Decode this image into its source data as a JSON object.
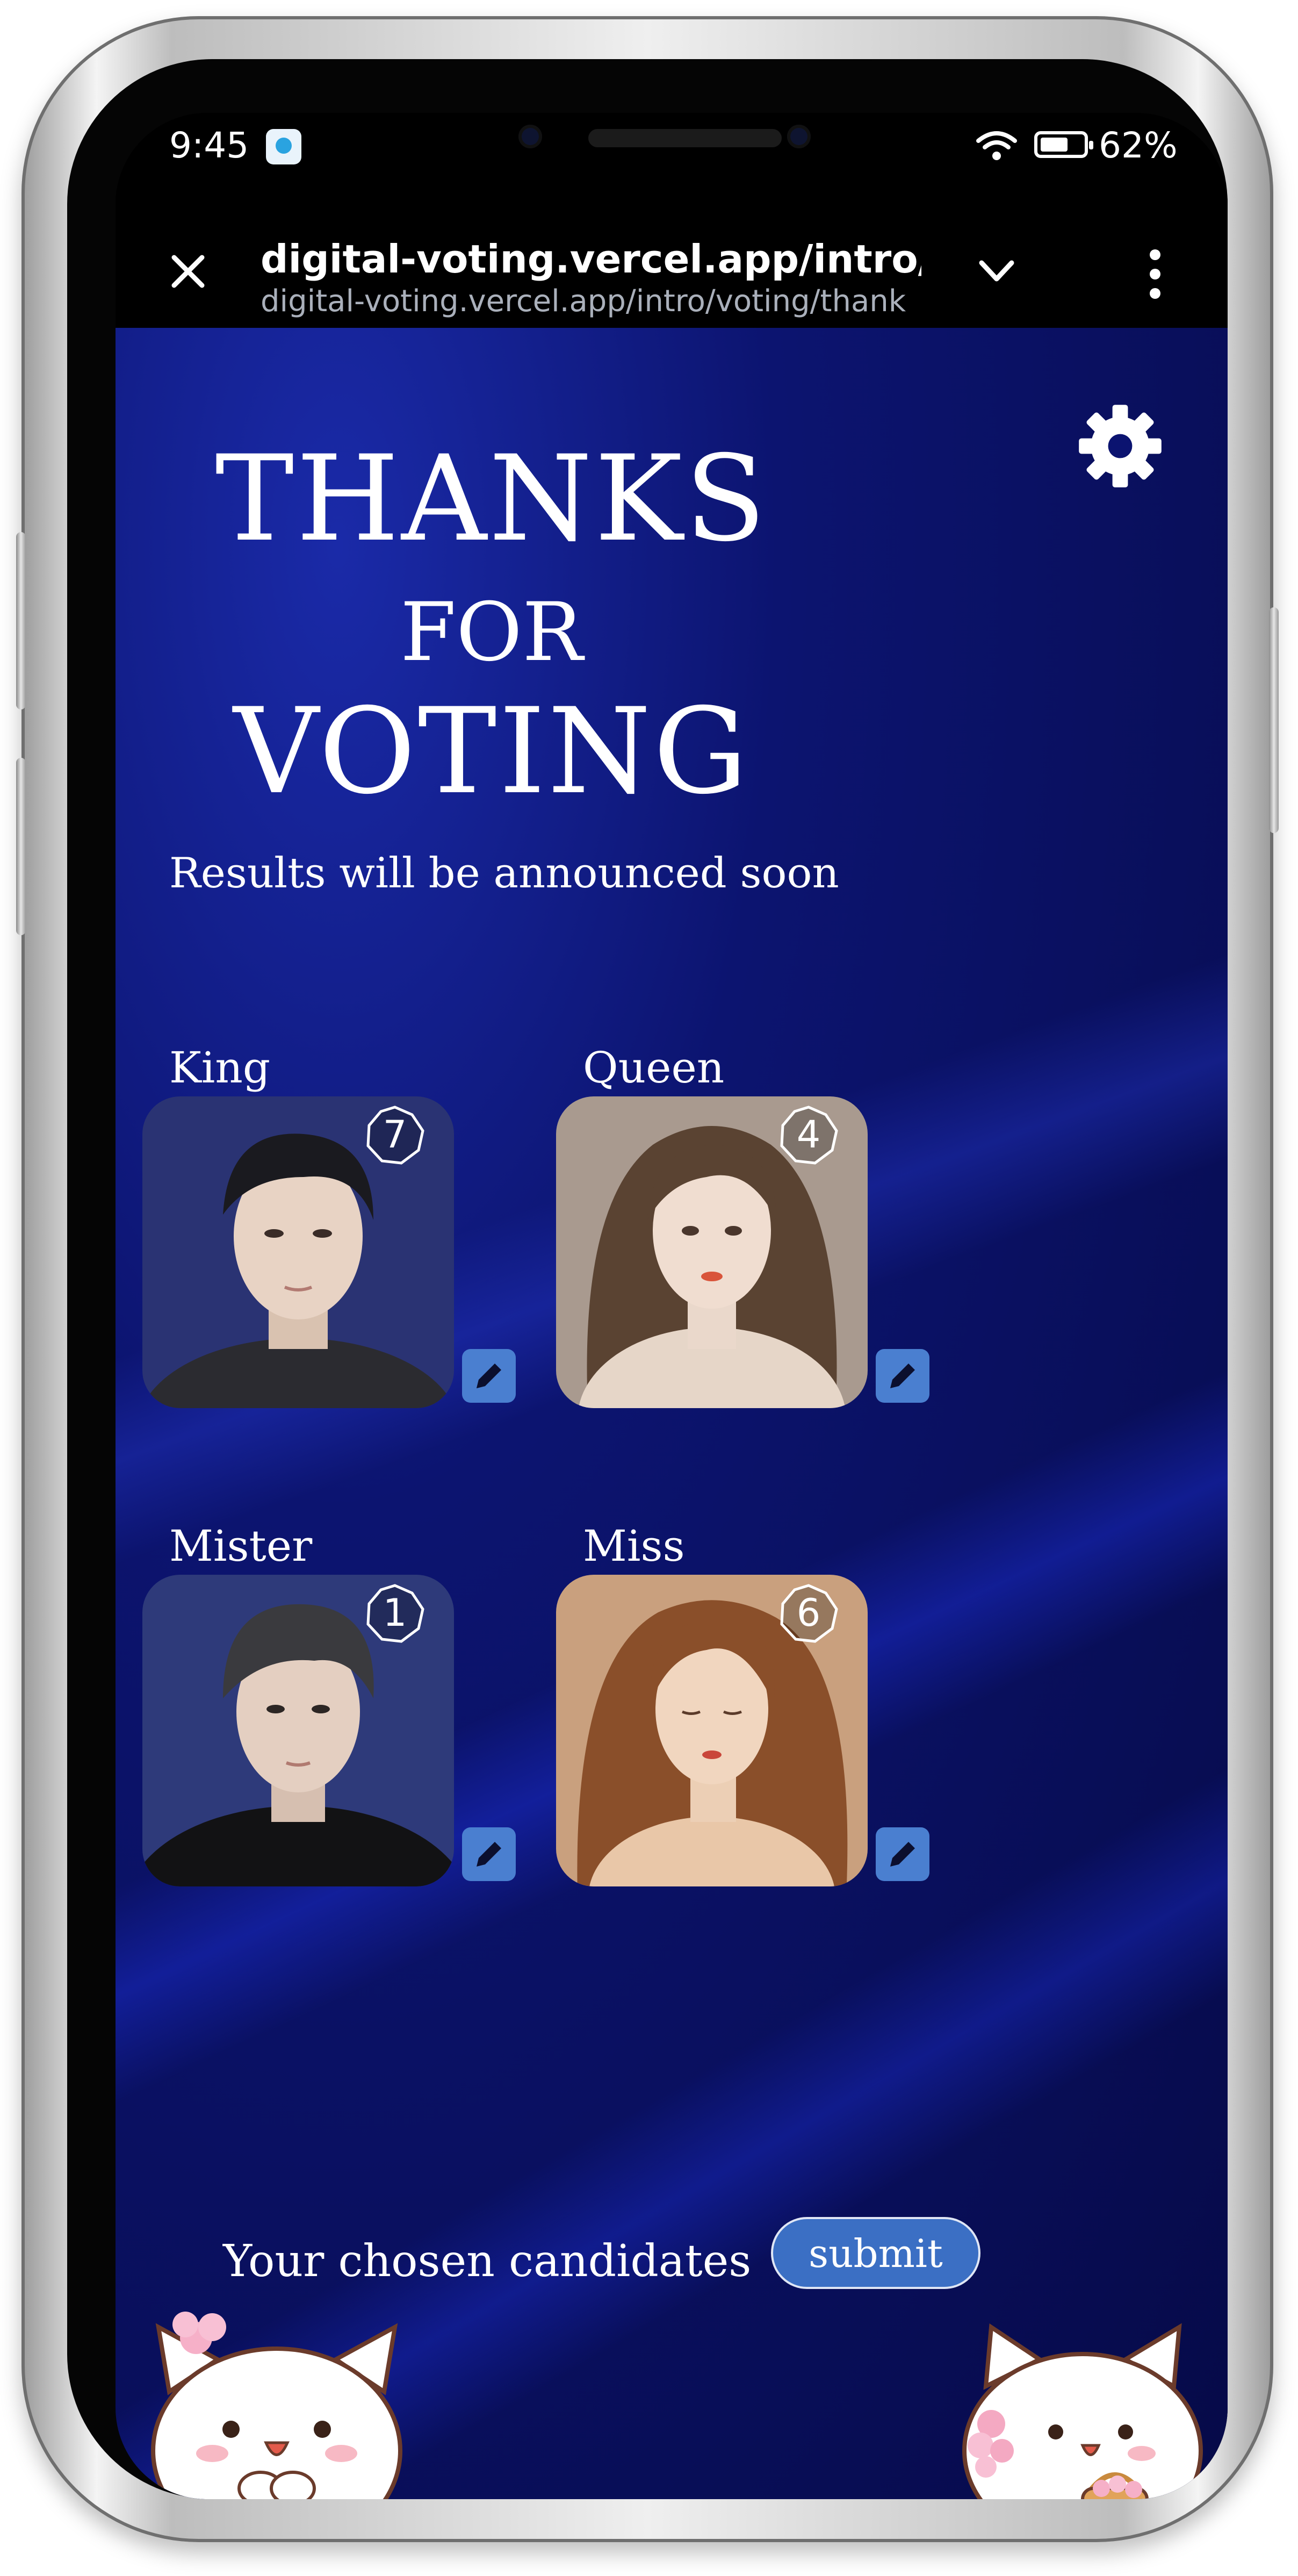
{
  "status_bar": {
    "time": "9:45",
    "battery": "62%"
  },
  "browser": {
    "url_primary": "digital-voting.vercel.app/intro/voti",
    "url_secondary": "digital-voting.vercel.app/intro/voting/thank"
  },
  "page": {
    "title_line1": "THANKS",
    "title_line2": "FOR",
    "title_line3": "VOTING",
    "subtitle": "Results will be announced soon",
    "candidates": [
      {
        "label": "King",
        "votes": "7"
      },
      {
        "label": "Queen",
        "votes": "4"
      },
      {
        "label": "Mister",
        "votes": "1"
      },
      {
        "label": "Miss",
        "votes": "6"
      }
    ],
    "chosen_label": "Your chosen candidates",
    "submit_label": "submit"
  },
  "icons": {
    "close": "close-icon",
    "chevron": "chevron-down-icon",
    "more": "more-vertical-icon",
    "settings": "gear-icon",
    "edit": "pencil-icon",
    "telegram": "telegram-icon",
    "wifi": "wifi-icon",
    "battery": "battery-icon"
  },
  "colors": {
    "background": "#0a1270",
    "accent": "#3b6fc4",
    "edit_button": "#4a7fd0"
  }
}
